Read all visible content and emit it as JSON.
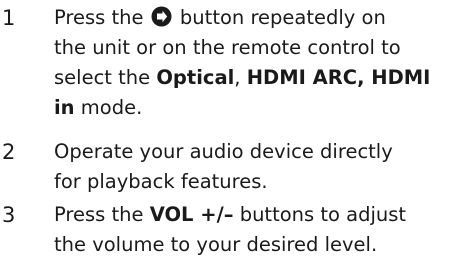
{
  "steps": [
    {
      "number": "1",
      "lines": [
        {
          "before_icon": "Press the ",
          "icon": "input-source-icon",
          "after_icon": " button repeatedly on"
        },
        {
          "text": "the unit or on the remote control to"
        },
        {
          "pre": "select the ",
          "bold1": "Optical",
          "mid": ", ",
          "bold2": "HDMI ARC, HDMI"
        },
        {
          "bold": "in",
          "post": " mode."
        }
      ]
    },
    {
      "number": "2",
      "lines": [
        {
          "text": "Operate your audio device directly"
        },
        {
          "text": "for playback features."
        }
      ]
    },
    {
      "number": "3",
      "lines": [
        {
          "pre": "Press the ",
          "bold": "VOL +/–",
          "post": " buttons to adjust"
        },
        {
          "text": "the volume to your desired level."
        }
      ]
    }
  ]
}
